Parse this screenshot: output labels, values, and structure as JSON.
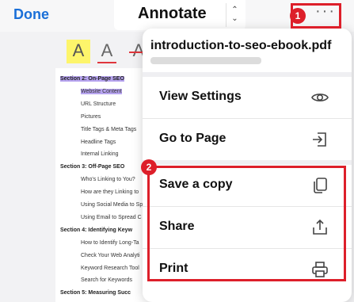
{
  "toolbar": {
    "done_label": "Done",
    "mode_label": "Annotate",
    "stepper_up": "⌃",
    "stepper_down": "⌄",
    "more_glyph": "···"
  },
  "tools": {
    "highlight": "A",
    "underline": "A",
    "strike": "A"
  },
  "document": {
    "lines": [
      {
        "text": "Section 2: On-Page SEO",
        "kind": "section-highlight"
      },
      {
        "text": "Website Content",
        "kind": "item-highlight"
      },
      {
        "text": "URL Structure",
        "kind": "item"
      },
      {
        "text": "Pictures",
        "kind": "item"
      },
      {
        "text": "Title Tags & Meta Tags",
        "kind": "item"
      },
      {
        "text": "Headline Tags",
        "kind": "item"
      },
      {
        "text": "Internal Linking",
        "kind": "item"
      },
      {
        "text": "Section 3: Off-Page SEO",
        "kind": "section"
      },
      {
        "text": "Who's Linking to You?",
        "kind": "item"
      },
      {
        "text": "How are they Linking to",
        "kind": "item"
      },
      {
        "text": "Using Social Media to Sp",
        "kind": "item"
      },
      {
        "text": "Using Email to Spread C",
        "kind": "item"
      },
      {
        "text": "Section 4:  Identifying Keyw",
        "kind": "section"
      },
      {
        "text": "How to Identify Long-Ta",
        "kind": "item"
      },
      {
        "text": "Check Your Web Analyti",
        "kind": "item"
      },
      {
        "text": "Keyword Research Tool",
        "kind": "item"
      },
      {
        "text": "Search for Keywords",
        "kind": "item"
      },
      {
        "text": "Section 5:  Measuring Succ",
        "kind": "section"
      }
    ]
  },
  "popover": {
    "file_name": "introduction-to-seo-ebook.pdf",
    "items": [
      {
        "label": "View Settings",
        "icon": "eye-icon"
      },
      {
        "label": "Go to Page",
        "icon": "go-to-page-icon"
      },
      {
        "label": "Save a copy",
        "icon": "copy-icon"
      },
      {
        "label": "Share",
        "icon": "share-icon"
      },
      {
        "label": "Print",
        "icon": "printer-icon"
      }
    ]
  },
  "annotations": {
    "badge_1": "1",
    "badge_2": "2",
    "highlight_color": "#dd1f2a"
  }
}
